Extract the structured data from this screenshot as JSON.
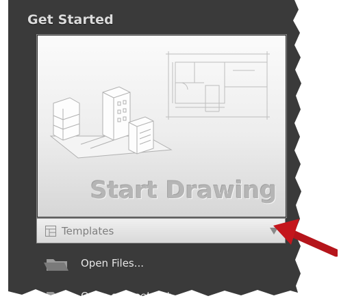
{
  "section": {
    "title": "Get Started"
  },
  "tile": {
    "label": "Start Drawing"
  },
  "templates": {
    "label": "Templates"
  },
  "actions": [
    {
      "label": "Open Files..."
    },
    {
      "label": "Open a Sheet Set..."
    }
  ],
  "colors": {
    "panel_bg": "#3a3a3a",
    "tile_bg": "#f2f2f2",
    "accent_arrow": "#c4161c"
  }
}
